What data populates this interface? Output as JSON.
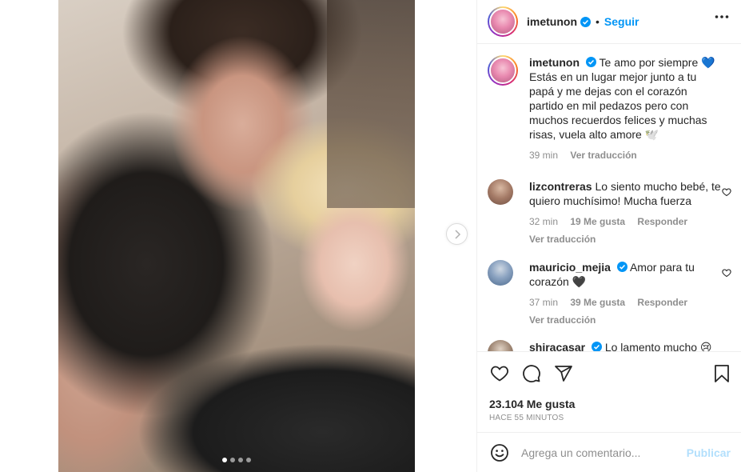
{
  "post": {
    "image_alt": "Couple selfie",
    "carousel_count": 4,
    "carousel_active": 1
  },
  "header": {
    "username": "imetunon",
    "separator": "•",
    "follow_label": "Seguir"
  },
  "caption": {
    "username": "imetunon",
    "text": "Te amo por siempre 💙 Estás en un lugar mejor junto a tu papá y me dejas con el corazón partido en mil pedazos pero con muchos recuerdos felices y muchas risas, vuela alto amore 🕊️",
    "time": "39 min",
    "translate": "Ver traducción"
  },
  "comments": [
    {
      "username": "lizcontreras",
      "verified": false,
      "text": "Lo siento mucho bebé, te quiero muchísimo! Mucha fuerza",
      "time": "32 min",
      "likes": "19 Me gusta",
      "reply": "Responder",
      "translate": "Ver traducción"
    },
    {
      "username": "mauricio_mejia",
      "verified": true,
      "text": "Amor para tu corazón 🖤",
      "time": "37 min",
      "likes": "39 Me gusta",
      "reply": "Responder",
      "translate": "Ver traducción"
    },
    {
      "username": "shiracasar",
      "verified": true,
      "text": "Lo lamento mucho 😢"
    }
  ],
  "stats": {
    "likes": "23.104 Me gusta",
    "ago": "HACE 55 MINUTOS"
  },
  "composer": {
    "placeholder": "Agrega un comentario...",
    "publish": "Publicar"
  },
  "colors": {
    "accent": "#0095f6",
    "verified": "#0095f6",
    "muted": "#8e8e8e",
    "publish_disabled": "#b2dffc"
  }
}
